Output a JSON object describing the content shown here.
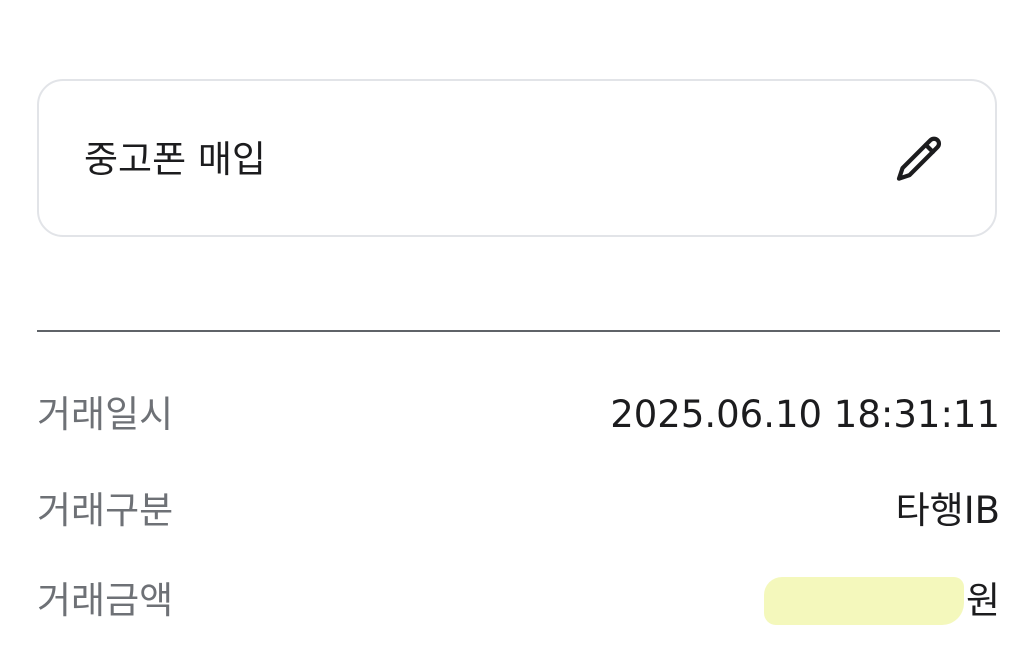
{
  "memo": {
    "text": "중고폰 매입",
    "edit_icon": "pencil-icon"
  },
  "details": {
    "rows": [
      {
        "label": "거래일시",
        "value": "2025.06.10 18:31:11"
      },
      {
        "label": "거래구분",
        "value": "타행IB"
      },
      {
        "label": "거래금액",
        "value": "원",
        "masked": true
      }
    ]
  },
  "colors": {
    "label": "#6e7176",
    "value": "#1c1c1e",
    "card_border": "#e2e4e8",
    "divider": "#5f6368",
    "mask_highlight": "#f3f8b8"
  }
}
